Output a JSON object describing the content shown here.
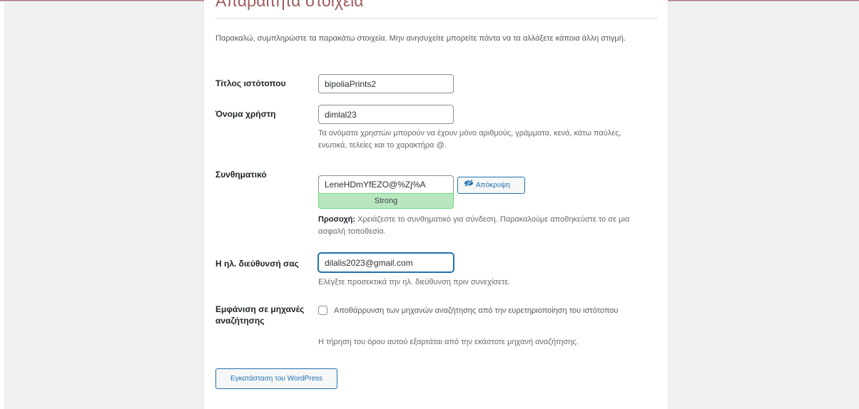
{
  "heading": "Απαραίτητα στοιχεία",
  "intro": "Παρακαλώ, συμπληρώστε τα παρακάτω στοιχεία. Μην ανησυχείτε μπορείτε πάντα να τα αλλάξετε κάποια άλλη στιγμή.",
  "site_title": {
    "label": "Τίτλος ιστότοπου",
    "value": "bipoliaPrints2"
  },
  "username": {
    "label": "Όνομα χρήστη",
    "value": "dimlal23",
    "description": "Τα ονόματα χρηστών μπορούν να έχουν μόνο αριθμούς, γράμματα, κενά, κάτω παύλες, ενωτικά, τελείες και το χαρακτήρα @."
  },
  "password": {
    "label": "Συνθηματικό",
    "value": "LeneHDmYfEZO@%Zj%A",
    "strength": "Strong",
    "hide_button": "Απόκρυψη",
    "hide_icon": "eye-slash-icon",
    "warning_bold": "Προσοχή:",
    "warning_text": " Χρειάζεστε το συνθηματικό για σύνδεση. Παρακαλούμε αποθηκεύστε το σε μια ασφαλή τοποθεσία."
  },
  "email": {
    "label": "Η ηλ. διεύθυνσή σας",
    "value": "dilalis2023@gmail.com",
    "description": "Ελέγξτε προσεκτικά την ηλ. διεύθυνση πριν συνεχίσετε."
  },
  "search_visibility": {
    "label": "Εμφάνιση σε μηχανές αναζήτησης",
    "checkbox_label": "Αποθάρρυνση των μηχανών αναζήτησης από την ευρετηριοποίηση του ιστότοπου",
    "checked": false,
    "description": "Η τήρηση του όρου αυτού εξαρτάται από την εκάστοτε μηχανή αναζήτησης."
  },
  "install_button": "Εγκατάσταση του WordPress",
  "colors": {
    "accent": "#2271b1",
    "strength_bg": "#b8e6bf",
    "heading": "#9c5b5b"
  }
}
